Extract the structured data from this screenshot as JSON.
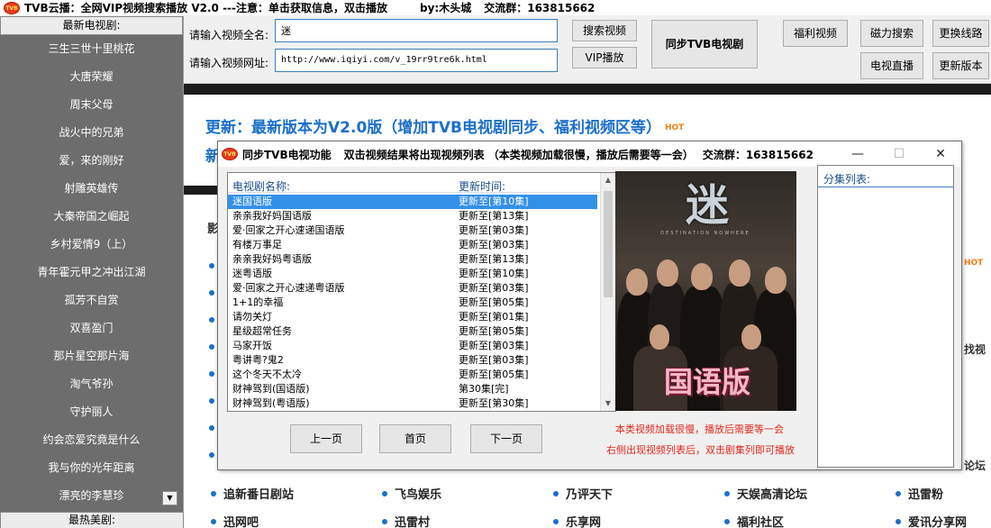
{
  "window": {
    "title": "TVB云播：全网VIP视频搜索播放 V2.0 ---注意：单击获取信息，双击播放",
    "author": "by:木头城",
    "group": "交流群：163815662"
  },
  "sidebar": {
    "header": "最新电视剧:",
    "items": [
      "三生三世十里桃花",
      "大唐荣耀",
      "周末父母",
      "战火中的兄弟",
      "爱，来的刚好",
      "射雕英雄传",
      "大秦帝国之崛起",
      "乡村爱情9（上）",
      "青年霍元甲之冲出江湖",
      "孤芳不自赏",
      "双喜盈门",
      "那片星空那片海",
      "淘气爷孙",
      "守护丽人",
      "约会恋爱究竟是什么",
      "我与你的光年距离",
      "漂亮的李慧珍"
    ],
    "footer_header": "最热美剧:"
  },
  "controls": {
    "name_label": "请输入视频全名:",
    "name_value": "迷",
    "url_label": "请输入视频网址:",
    "url_value": "http://www.iqiyi.com/v_19rr9tre6k.html",
    "btn_search": "搜索视频",
    "btn_vip": "VIP播放",
    "btn_sync": "同步TVB电视剧",
    "btn_welfare": "福利视频",
    "btn_magnet": "磁力搜索",
    "btn_line": "更换线路",
    "btn_live": "电视直播",
    "btn_update": "更新版本"
  },
  "web": {
    "headline": "更新：最新版本为V2.0版（增加TVB电视剧同步、福利视频区等）",
    "hot": "HOT",
    "frag_new": "新",
    "frag_ying": "影",
    "frag_right1": "找视",
    "frag_right2": "论坛",
    "links": [
      "追新番日剧站",
      "飞鸟娱乐",
      "乃评天下",
      "天娱高清论坛",
      "迅雷粉",
      "迅网吧",
      "迅雷村",
      "乐享网",
      "福利社区",
      "爱讯分享网"
    ]
  },
  "dialog": {
    "title": "同步TVB电视功能",
    "subtitle": "双击视频结果将出现视频列表 （本类视频加载很慢，播放后需要等一会）",
    "group": "交流群：163815662",
    "col_name": "电视剧名称:",
    "col_time": "更新时间:",
    "rows": [
      {
        "name": "迷国语版",
        "time": "更新至[第10集]"
      },
      {
        "name": "亲亲我好妈国语版",
        "time": "更新至[第13集]"
      },
      {
        "name": "爱·回家之开心速递国语版",
        "time": "更新至[第03集]"
      },
      {
        "name": "有楼万事足",
        "time": "更新至[第03集]"
      },
      {
        "name": "亲亲我好妈粤语版",
        "time": "更新至[第13集]"
      },
      {
        "name": "迷粤语版",
        "time": "更新至[第10集]"
      },
      {
        "name": "爱·回家之开心速递粤语版",
        "time": "更新至[第03集]"
      },
      {
        "name": "1+1的幸福",
        "time": "更新至[第05集]"
      },
      {
        "name": "请勿关灯",
        "time": "更新至[第01集]"
      },
      {
        "name": "星级超常任务",
        "time": "更新至[第05集]"
      },
      {
        "name": "马家开饭",
        "time": "更新至[第03集]"
      },
      {
        "name": "粤讲粤?鬼2",
        "time": "更新至[第03集]"
      },
      {
        "name": "这个冬天不太冷",
        "time": "更新至[第05集]"
      },
      {
        "name": "财神驾到(国语版)",
        "time": "第30集[完]"
      },
      {
        "name": "财神驾到(粤语版)",
        "time": "更新至[第30集]"
      }
    ],
    "poster_title": "迷",
    "poster_sub": "DESTINATION NOWHERE",
    "poster_badge": "国语版",
    "btn_prev": "上一页",
    "btn_home": "首页",
    "btn_next": "下一页",
    "note1": "本类视频加载很慢，播放后需要等一会",
    "note2": "右侧出现视频列表后，双击剧集列即可播放",
    "episode_label": "分集列表:",
    "win_min": "—",
    "win_max": "☐",
    "win_close": "✕"
  },
  "icons": {
    "app": "tvb-logo-icon",
    "scroll_up": "▲",
    "scroll_down": "▼"
  },
  "colors": {
    "accent": "#1b6fc9",
    "selection": "#3390e8",
    "warning": "#e0281c",
    "hot": "#f07d12",
    "sidebar_bg": "#6d6d6d"
  }
}
